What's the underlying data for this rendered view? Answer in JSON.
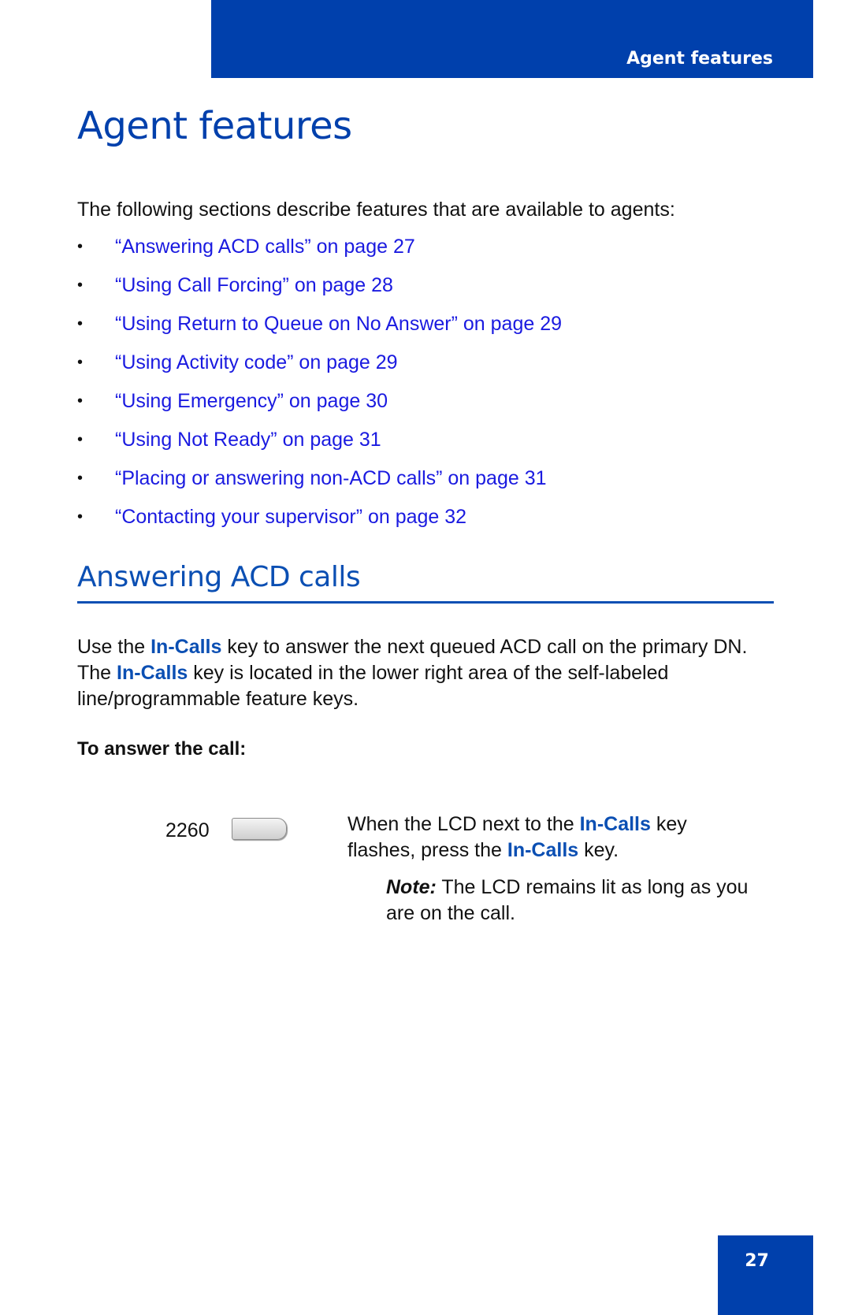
{
  "header": {
    "running_title": "Agent features"
  },
  "page_title": "Agent features",
  "intro": "The following sections describe features that are available to agents:",
  "toc": [
    {
      "bullet": "•",
      "label": "“Answering ACD calls” on page 27"
    },
    {
      "bullet": "•",
      "label": "“Using Call Forcing” on page 28"
    },
    {
      "bullet": "•",
      "label": "“Using Return to Queue on No Answer” on page 29"
    },
    {
      "bullet": "•",
      "label": "“Using Activity code” on page 29"
    },
    {
      "bullet": "•",
      "label": "“Using Emergency” on page 30"
    },
    {
      "bullet": "•",
      "label": "“Using Not Ready” on page 31"
    },
    {
      "bullet": "•",
      "label": "“Placing or answering non-ACD calls” on page 31"
    },
    {
      "bullet": "•",
      "label": "“Contacting your supervisor” on page 32"
    }
  ],
  "section": {
    "title": "Answering ACD calls",
    "para": {
      "t1": "Use the ",
      "key": "In-Calls",
      "t2": " key to answer the next queued ACD call on the primary DN. The ",
      "t3": " key is located in the lower right area of the self-labeled line/programmable feature keys."
    },
    "procedure_heading": "To answer the call:",
    "step": {
      "key_number": "2260",
      "t1": "When the LCD next to the ",
      "key": "In-Calls",
      "t2": " key flashes, press the ",
      "t3": " key."
    },
    "note": {
      "label": "Note:",
      "text": " The LCD remains lit as long as you are on the call."
    }
  },
  "footer": {
    "page_number": "27"
  },
  "colors": {
    "brand_blue": "#0040ac",
    "link_blue": "#1a1ae0",
    "key_blue": "#0b4fb3"
  }
}
